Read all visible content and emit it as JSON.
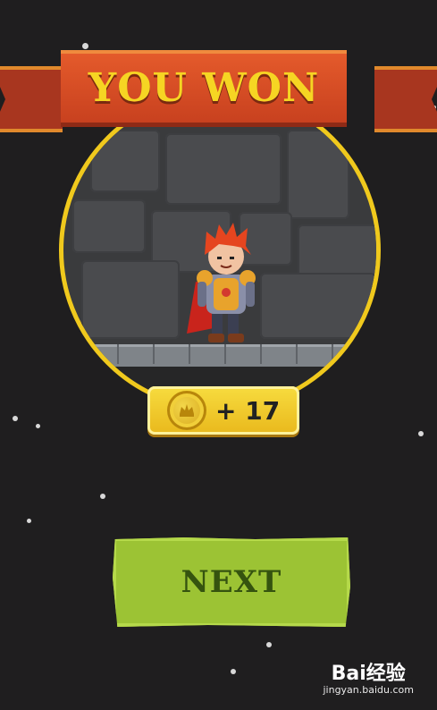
{
  "banner": {
    "title": "YOU WON"
  },
  "reward": {
    "amount_text": "+ 17",
    "icon": "coin-icon"
  },
  "next_button": {
    "label": "NEXT"
  },
  "watermark": {
    "logo_text": "Bai经验",
    "url": "jingyan.baidu.com"
  },
  "colors": {
    "background": "#1f1e1f",
    "banner_red": "#d24a24",
    "banner_text": "#f6d523",
    "ring_gold": "#f0c91d",
    "button_green": "#9cc334",
    "button_text": "#35530f"
  }
}
